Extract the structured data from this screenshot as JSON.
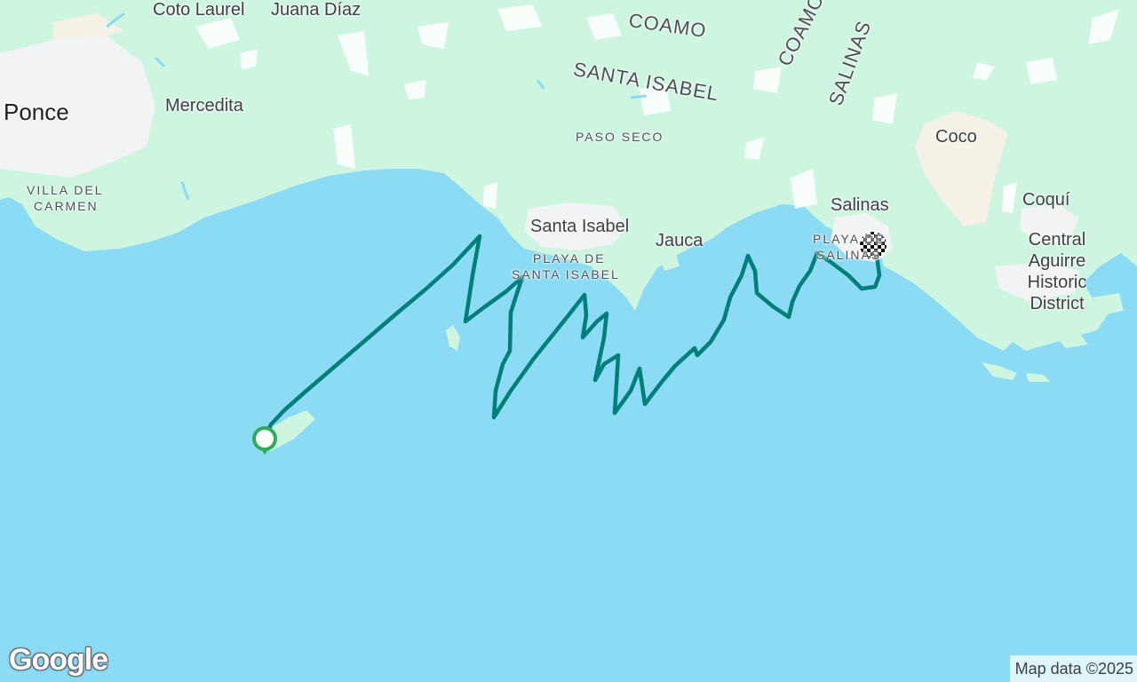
{
  "map": {
    "colors": {
      "water": "#8bdbf4",
      "land": "#cdf5df",
      "urban": "#f1f3f4",
      "urban_warm": "#f5f1e6",
      "route": "#007e7a",
      "start_marker": "#2eaa5a"
    },
    "labels": {
      "coto_laurel": "Coto Laurel",
      "juana_diaz": "Juana Díaz",
      "coamo": "COAMO",
      "coamo_partial": "COAMO",
      "salinas_muni": "SALINAS",
      "santa_isabel_muni": "SANTA ISABEL",
      "ponce": "Ponce",
      "mercedita": "Mercedita",
      "paso_seco": "PASO SECO",
      "coco": "Coco",
      "villa_del_carmen_1": "VILLA DEL",
      "villa_del_carmen_2": "CARMEN",
      "salinas_town": "Salinas",
      "coqui": "Coquí",
      "santa_isabel_town": "Santa Isabel",
      "jauca": "Jauca",
      "playa_de_salinas": "PLAYA DE",
      "playa_de_salinas_2": "SALINAS",
      "playa_de_santa_isabel_1": "PLAYA DE",
      "playa_de_santa_isabel_2": "SANTA ISABEL",
      "central_aguirre": "Central Aguirre Historic District"
    },
    "markers": {
      "start": "start-marker",
      "finish": "finish-flag-icon"
    }
  },
  "footer": {
    "logo": "Google",
    "attribution": "Map data ©2025"
  }
}
